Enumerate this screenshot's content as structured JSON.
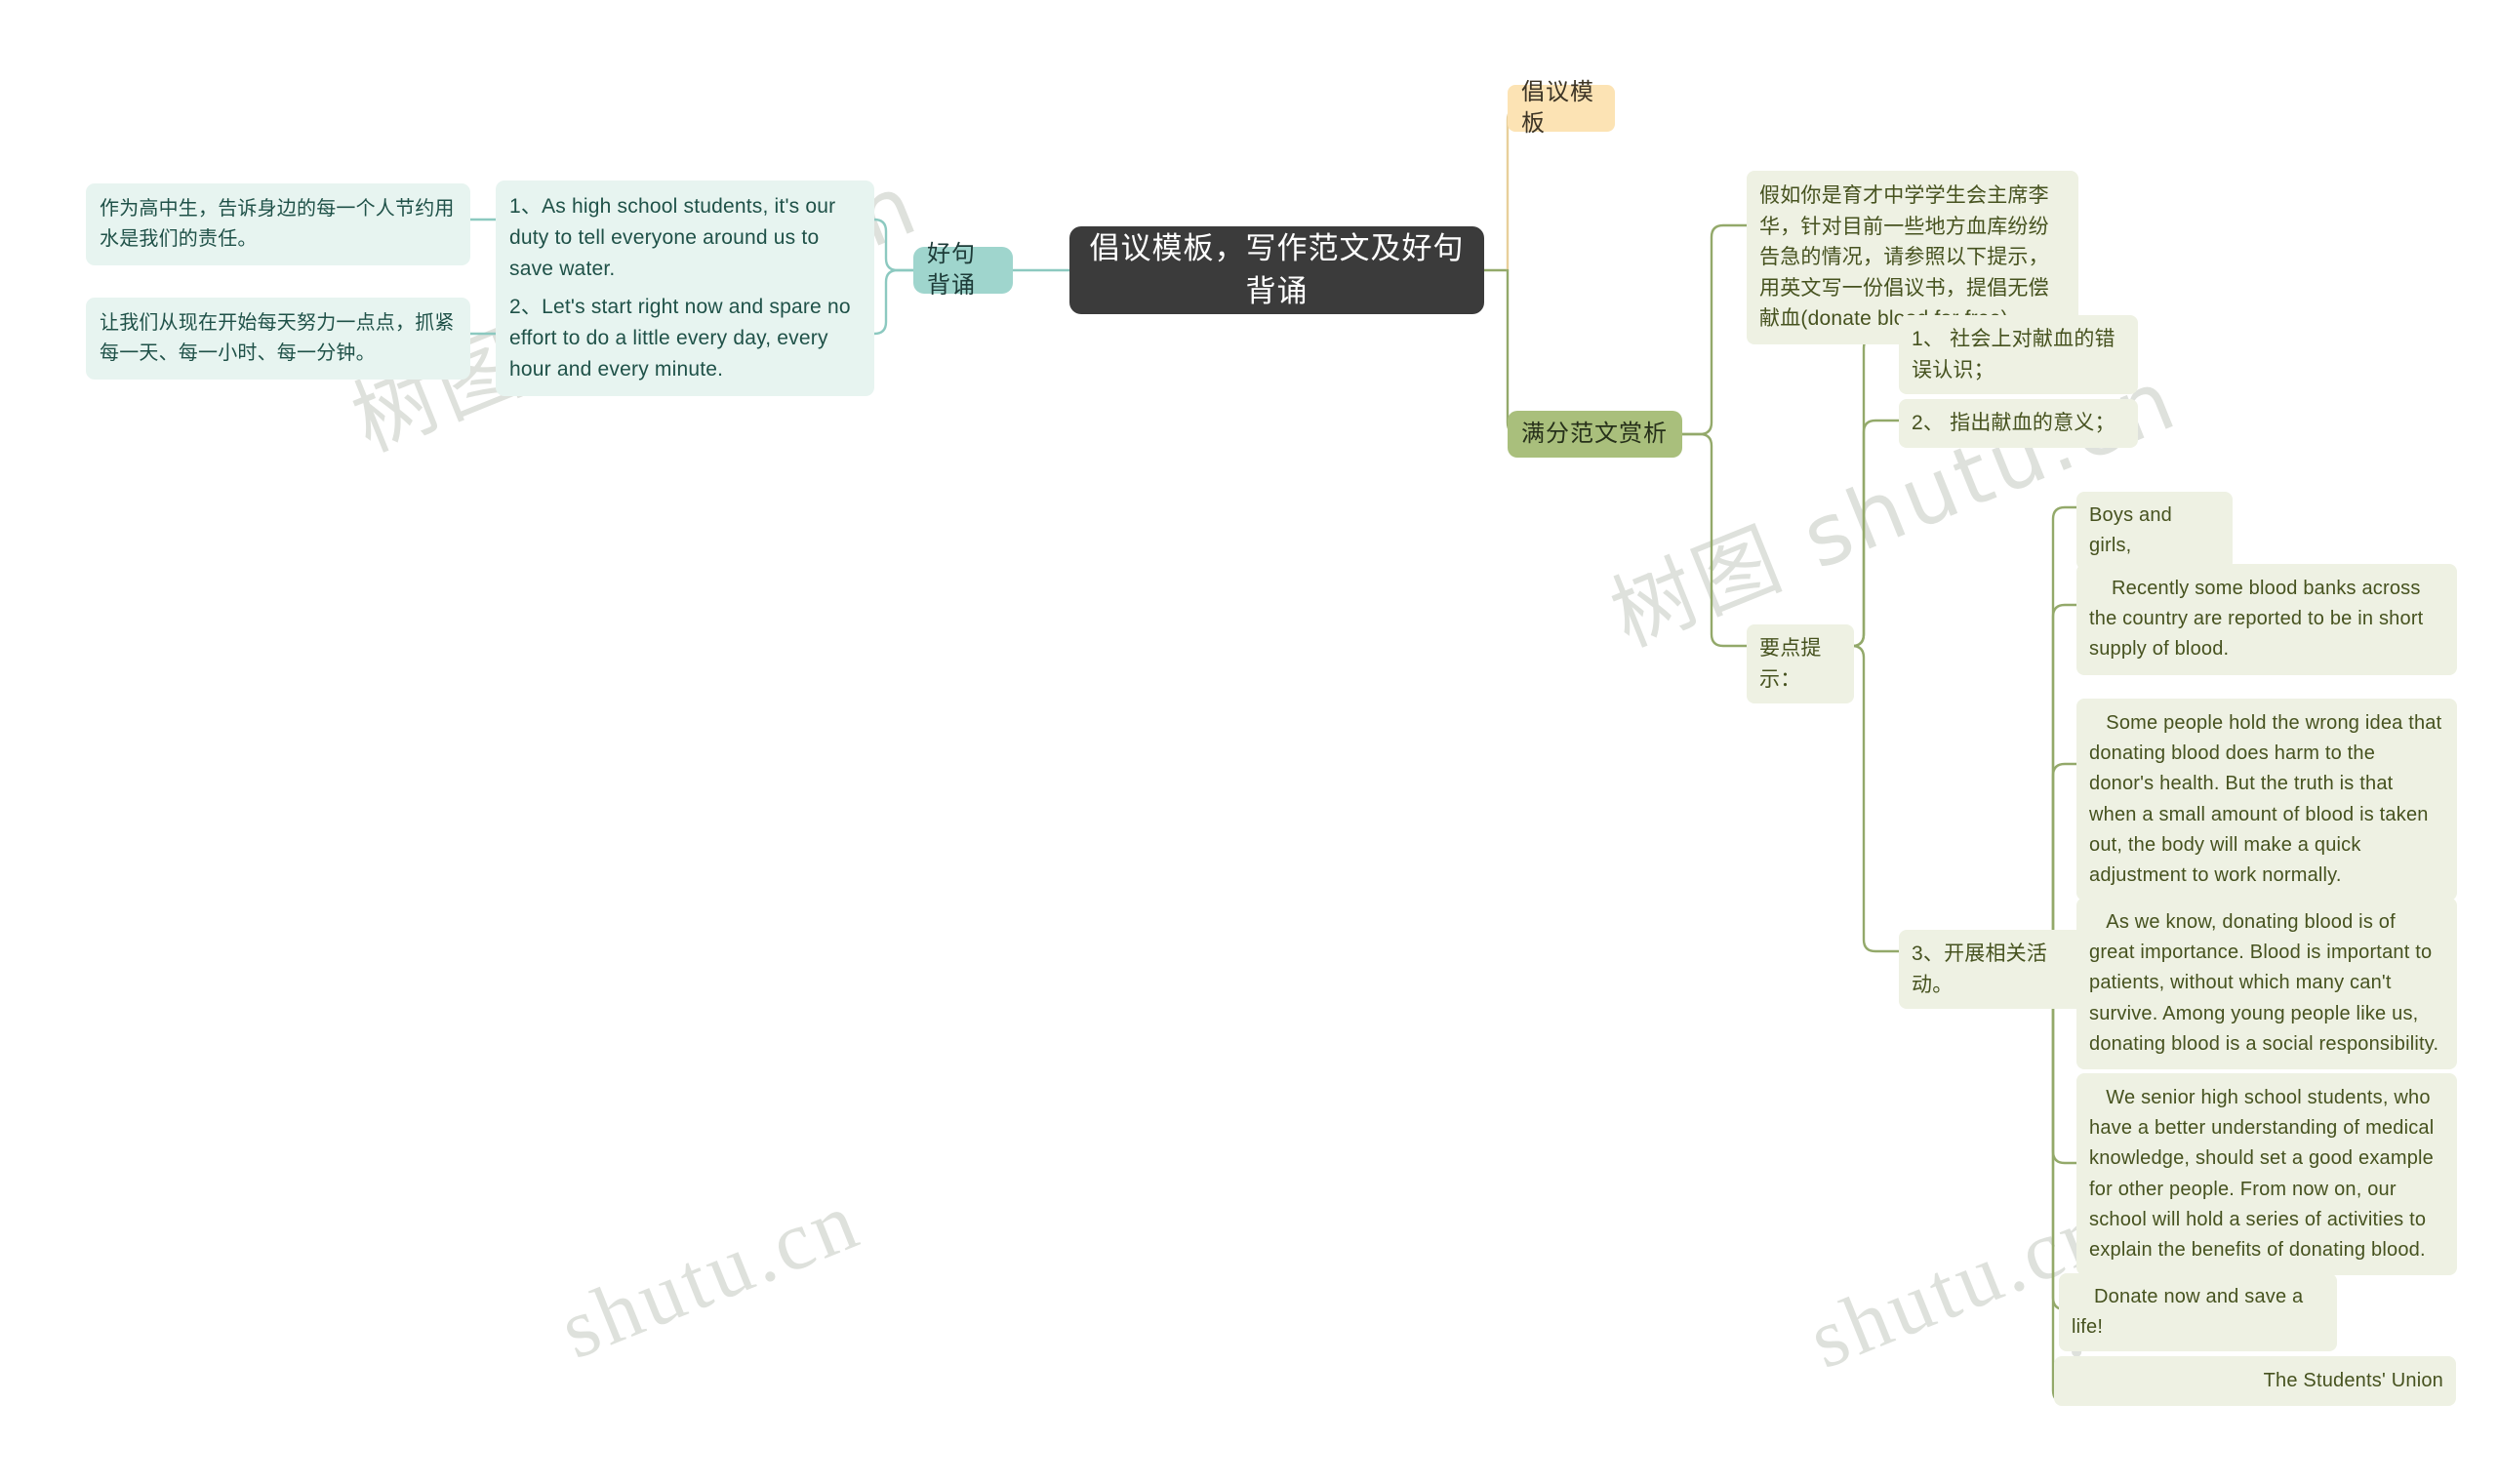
{
  "theme": {
    "background": "#ffffff",
    "root_bg": "#3b3b3b",
    "root_fg": "#ffffff",
    "teal_branch_bg": "#9fd5cd",
    "mint_leaf_bg": "#e7f4f0",
    "mint_leaf_fg": "#1f5148",
    "orange_branch_bg": "#fce3b4",
    "olive_branch_bg": "#a9bf7c",
    "olive_leaf_bg": "#eef1e3",
    "olive_leaf_fg": "#46521f",
    "teal_line": "#8cc9c0",
    "orange_line": "#e8cf9a",
    "olive_line": "#93a96a",
    "watermark_color": "#d9dcd6"
  },
  "watermarks": [
    {
      "text": "树图 shutu.cn"
    },
    {
      "text": "树图 shutu.cn"
    },
    {
      "text": "shutu.cn"
    },
    {
      "text": "shutu.cn"
    },
    {
      "text": ".cn"
    }
  ],
  "root": {
    "title": "倡议模板，写作范文及好句背诵"
  },
  "left_branch": {
    "label": "好句背诵",
    "items": [
      {
        "english": "1、As high school students, it's our duty to tell everyone around us to save water.",
        "chinese": "作为高中生，告诉身边的每一个人节约用水是我们的责任。"
      },
      {
        "english": "2、Let's start right now and spare no effort to do a little every day, every hour and every minute.",
        "chinese": "让我们从现在开始每天努力一点点，抓紧每一天、每一小时、每一分钟。"
      }
    ]
  },
  "right_branches": [
    {
      "label": "倡议模板",
      "children": []
    },
    {
      "label": "满分范文赏析",
      "prompt": "假如你是育才中学学生会主席李华，针对目前一些地方血库纷纷告急的情况，请参照以下提示，用英文写一份倡议书，提倡无偿献血(donate blood for free)。",
      "hints_label": "要点提示：",
      "hints": [
        "1、 社会上对献血的错误认识；",
        "2、 指出献血的意义；",
        "3、开展相关活动。"
      ],
      "essay": [
        "Boys and girls,",
        "    Recently some blood banks across the country are reported to be in short supply of blood.",
        "   Some people hold the wrong idea that donating blood does harm to the donor's health. But the truth is that when a small amount of blood is taken out, the body will make a quick adjustment to work normally.",
        "   As we know, donating blood is of great importance. Blood is important to patients, without which many can't survive. Among young people like us, donating blood is a social responsibility.",
        "   We senior high school students, who have a better understanding of medical knowledge, should set a good example for other people. From now on, our school will hold a series of activities to explain the benefits of donating blood.",
        "    Donate now and save a life!",
        "The Students' Union"
      ]
    }
  ]
}
